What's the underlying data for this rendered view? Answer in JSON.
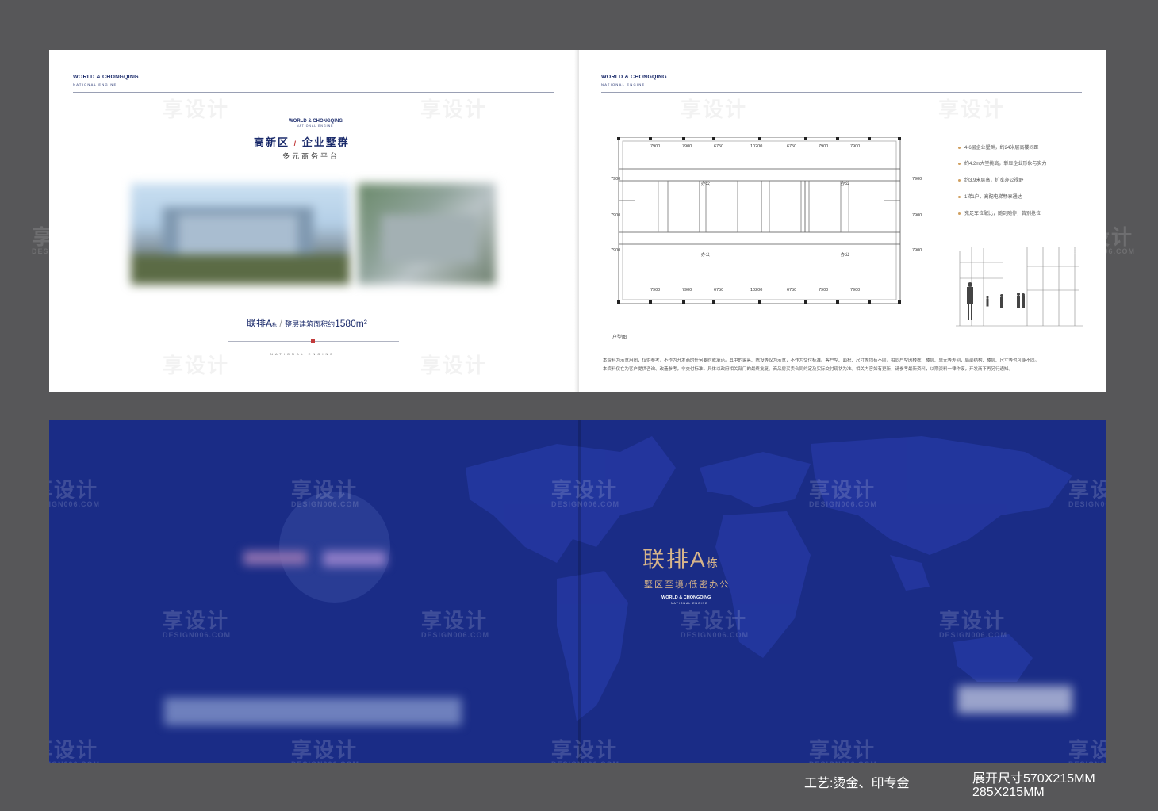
{
  "left_page": {
    "brand": "WORLD & CHONGQING",
    "brand_sub": "NATIONAL ENGINE",
    "logo_brand": "WORLD & CHONGQING",
    "logo_sub": "NATIONAL ENGINE",
    "headline_a": "高新区",
    "headline_sep": "/",
    "headline_b": "企业墅群",
    "subline": "多元商务平台",
    "unit_label": "联排A",
    "unit_suffix": "栋",
    "unit_sep": "/",
    "area_label": "整层建筑面积约",
    "area_value": "1580m²",
    "footer_tag": "NATIONAL ENGINE"
  },
  "right_page": {
    "brand": "WORLD & CHONGQING",
    "brand_sub": "NATIONAL ENGINE",
    "dims_top": [
      "7900",
      "7900",
      "6750",
      "10200",
      "6750",
      "7900",
      "7900"
    ],
    "dims_bottom": [
      "7900",
      "7900",
      "6750",
      "10200",
      "6750",
      "7900",
      "7900"
    ],
    "dims_left": [
      "7900",
      "7900",
      "7900"
    ],
    "dims_right": [
      "7900",
      "7900",
      "7900"
    ],
    "room_office": "办公",
    "features": [
      "4-6层企业墅群，约24米层高楼间距",
      "约4.2m大堂挑高，彰显企业形象与实力",
      "约3.9米层高，扩宽办公视野",
      "1梯1户，高配电梯畅享通达",
      "充足车位配比，随到随停，告别抢位"
    ],
    "plan_caption": "户型图",
    "disclaimer": [
      "本资料为示意用图，仅供参考，不作为开发商的任何要约或承诺。其中的家具、陈设等仅为示意，不作为交付标准。客户型、面积、尺寸等均有不同，相同户型因楼栋、楼层、单元等差别，局部结构、楼层、尺寸等也可能不同。",
      "本资料仅在为客户提供咨询、改造参考，非交付标准，具体以政府相关部门的最终批复、商品房买卖合同约定及实际交付现状为准。相关内容如有更新，请参考最新资料，以期资料一律作废，开发商不再另行通知。"
    ]
  },
  "cover": {
    "title_main": "联排A",
    "title_suffix": "栋",
    "tagline_a": "墅区至境",
    "tagline_sep": "/",
    "tagline_b": "低密办公",
    "brand": "WORLD & CHONGQING",
    "brand_sub": "NATIONAL ENGINE",
    "color_bg": "#1a2c86",
    "color_gold": "#d6b48a"
  },
  "watermark": {
    "text": "享设计",
    "url": "DESIGN006.COM"
  },
  "specs": {
    "process": "工艺:烫金、印专金",
    "size_open": "展开尺寸570X215MM",
    "size_single": "285X215MM"
  }
}
